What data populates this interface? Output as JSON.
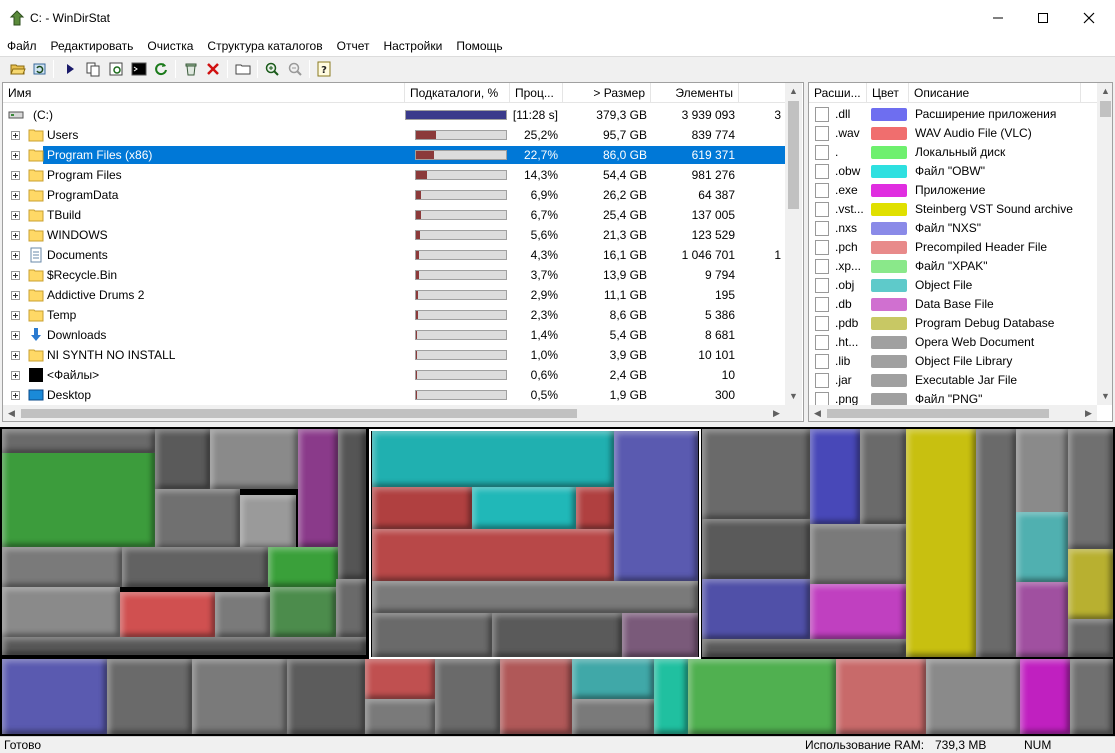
{
  "window": {
    "title": "C: - WinDirStat"
  },
  "menu": [
    "Файл",
    "Редактировать",
    "Очистка",
    "Структура каталогов",
    "Отчет",
    "Настройки",
    "Помощь"
  ],
  "tree": {
    "headers": {
      "name": "Имя",
      "subdirs": "Подкаталоги, %",
      "percent": "Проц...",
      "size": "> Размер",
      "items": "Элементы"
    },
    "root": {
      "name": "(C:)",
      "percent": "[11:28 s]",
      "size": "379,3 GB",
      "items": "3 939 093",
      "extra": "3",
      "fill": 1.0
    },
    "rows": [
      {
        "name": "Users",
        "percent": "25,2%",
        "size": "95,7 GB",
        "items": "839 774",
        "fill": 0.252,
        "icon": "folder"
      },
      {
        "name": "Program Files (x86)",
        "percent": "22,7%",
        "size": "86,0 GB",
        "items": "619 371",
        "fill": 0.227,
        "icon": "folder",
        "selected": true
      },
      {
        "name": "Program Files",
        "percent": "14,3%",
        "size": "54,4 GB",
        "items": "981 276",
        "fill": 0.143,
        "icon": "folder"
      },
      {
        "name": "ProgramData",
        "percent": "6,9%",
        "size": "26,2 GB",
        "items": "64 387",
        "fill": 0.069,
        "icon": "folder"
      },
      {
        "name": "TBuild",
        "percent": "6,7%",
        "size": "25,4 GB",
        "items": "137 005",
        "fill": 0.067,
        "icon": "folder"
      },
      {
        "name": "WINDOWS",
        "percent": "5,6%",
        "size": "21,3 GB",
        "items": "123 529",
        "fill": 0.056,
        "icon": "folder"
      },
      {
        "name": "Documents",
        "percent": "4,3%",
        "size": "16,1 GB",
        "items": "1 046 701",
        "extra": "1",
        "fill": 0.043,
        "icon": "document"
      },
      {
        "name": "$Recycle.Bin",
        "percent": "3,7%",
        "size": "13,9 GB",
        "items": "9 794",
        "fill": 0.037,
        "icon": "folder"
      },
      {
        "name": "Addictive Drums 2",
        "percent": "2,9%",
        "size": "11,1 GB",
        "items": "195",
        "fill": 0.029,
        "icon": "folder"
      },
      {
        "name": "Temp",
        "percent": "2,3%",
        "size": "8,6 GB",
        "items": "5 386",
        "fill": 0.023,
        "icon": "folder"
      },
      {
        "name": "Downloads",
        "percent": "1,4%",
        "size": "5,4 GB",
        "items": "8 681",
        "fill": 0.014,
        "icon": "download"
      },
      {
        "name": "NI SYNTH NO INSTALL",
        "percent": "1,0%",
        "size": "3,9 GB",
        "items": "10 101",
        "fill": 0.01,
        "icon": "folder"
      },
      {
        "name": "<Файлы>",
        "percent": "0,6%",
        "size": "2,4 GB",
        "items": "10",
        "fill": 0.006,
        "icon": "files"
      },
      {
        "name": "Desktop",
        "percent": "0,5%",
        "size": "1,9 GB",
        "items": "300",
        "fill": 0.005,
        "icon": "desktop"
      }
    ]
  },
  "extensions": {
    "headers": {
      "ext": "Расши...",
      "color": "Цвет",
      "desc": "Описание"
    },
    "rows": [
      {
        "ext": ".dll",
        "color": "#6e6ef0",
        "desc": "Расширение приложения"
      },
      {
        "ext": ".wav",
        "color": "#f06e6e",
        "desc": "WAV Audio File (VLC)"
      },
      {
        "ext": ".",
        "color": "#6ef06e",
        "desc": "Локальный диск"
      },
      {
        "ext": ".obw",
        "color": "#2ee0e0",
        "desc": "Файл \"OBW\""
      },
      {
        "ext": ".exe",
        "color": "#e02ee0",
        "desc": "Приложение"
      },
      {
        "ext": ".vst...",
        "color": "#e0e000",
        "desc": "Steinberg VST Sound archive"
      },
      {
        "ext": ".nxs",
        "color": "#8a8ae8",
        "desc": "Файл \"NXS\""
      },
      {
        "ext": ".pch",
        "color": "#e88a8a",
        "desc": "Precompiled Header File"
      },
      {
        "ext": ".xp...",
        "color": "#8ae88a",
        "desc": "Файл \"XPAK\""
      },
      {
        "ext": ".obj",
        "color": "#5ecaca",
        "desc": "Object File"
      },
      {
        "ext": ".db",
        "color": "#d070d0",
        "desc": "Data Base File"
      },
      {
        "ext": ".pdb",
        "color": "#c8c864",
        "desc": "Program Debug Database"
      },
      {
        "ext": ".ht...",
        "color": "#a0a0a0",
        "desc": "Opera Web Document"
      },
      {
        "ext": ".lib",
        "color": "#a0a0a0",
        "desc": "Object File Library"
      },
      {
        "ext": ".jar",
        "color": "#a0a0a0",
        "desc": "Executable Jar File"
      },
      {
        "ext": ".png",
        "color": "#a0a0a0",
        "desc": "Файл \"PNG\""
      }
    ]
  },
  "status": {
    "ready": "Готово",
    "ram_label": "Использование RAM:",
    "ram_value": "739,3 MB",
    "num": "NUM"
  }
}
